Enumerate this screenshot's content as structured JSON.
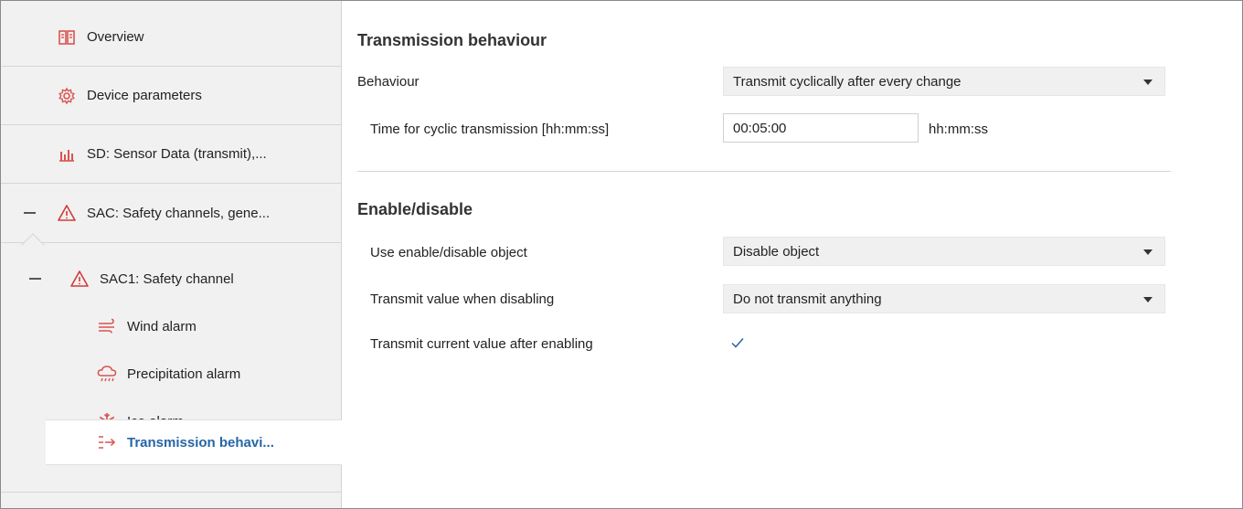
{
  "sidebar": {
    "items": [
      {
        "label": "Overview",
        "icon": "book-icon"
      },
      {
        "label": "Device parameters",
        "icon": "gear-icon"
      },
      {
        "label": "SD: Sensor Data (transmit),...",
        "icon": "bar-chart-icon"
      },
      {
        "label": "SAC: Safety channels, gene...",
        "icon": "warning-icon"
      },
      {
        "label": "SAC1:  Safety channel",
        "icon": "warning-icon"
      },
      {
        "label": "Wind alarm",
        "icon": "wind-icon"
      },
      {
        "label": "Precipitation alarm",
        "icon": "rain-icon"
      },
      {
        "label": "Ice alarm",
        "icon": "snowflake-icon"
      },
      {
        "label": "Transmission behavi...",
        "icon": "transmit-icon"
      }
    ]
  },
  "colors": {
    "accent": "#2566a6",
    "warning": "#d23a3a",
    "icon_red": "#d9534f"
  },
  "main": {
    "section1": {
      "title": "Transmission behaviour",
      "behaviour_label": "Behaviour",
      "behaviour_value": "Transmit cyclically after every change",
      "cyclic_label": "Time for cyclic transmission [hh:mm:ss]",
      "cyclic_value": "00:05:00",
      "cyclic_unit": "hh:mm:ss"
    },
    "section2": {
      "title": "Enable/disable",
      "use_label": "Use enable/disable object",
      "use_value": "Disable object",
      "disabling_label": "Transmit value when disabling",
      "disabling_value": "Do not transmit anything",
      "enabling_label": "Transmit current value after enabling",
      "enabling_checked": true
    }
  }
}
